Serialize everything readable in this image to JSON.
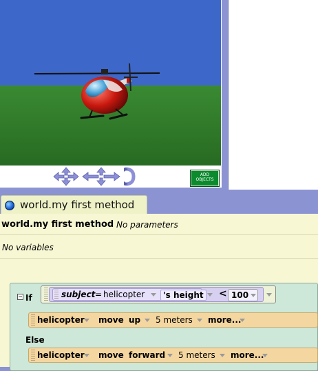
{
  "scene": {
    "add_objects_label": "ADD\nOBJECTS",
    "controls": [
      "move-arrows",
      "pan-arrows",
      "turn-control"
    ],
    "sky_color": "#3d67c8",
    "grass_color": "#2f7a2a"
  },
  "editor": {
    "tab_title": "world.my first method",
    "method_name": "world.my first method",
    "params_text": "No parameters",
    "vars_text": "No variables"
  },
  "if_block": {
    "if_label": "If",
    "condition": {
      "subject_label": "subject",
      "equals": "=",
      "object": "helicopter",
      "property": "'s height",
      "operator": "<",
      "value": "100"
    },
    "else_label": "Else"
  },
  "statements": [
    {
      "object": "helicopter",
      "verb": "move",
      "direction": "up",
      "amount": "5 meters",
      "more": "more..."
    },
    {
      "object": "helicopter",
      "verb": "move",
      "direction": "forward",
      "amount": "5 meters",
      "more": "more..."
    }
  ]
}
